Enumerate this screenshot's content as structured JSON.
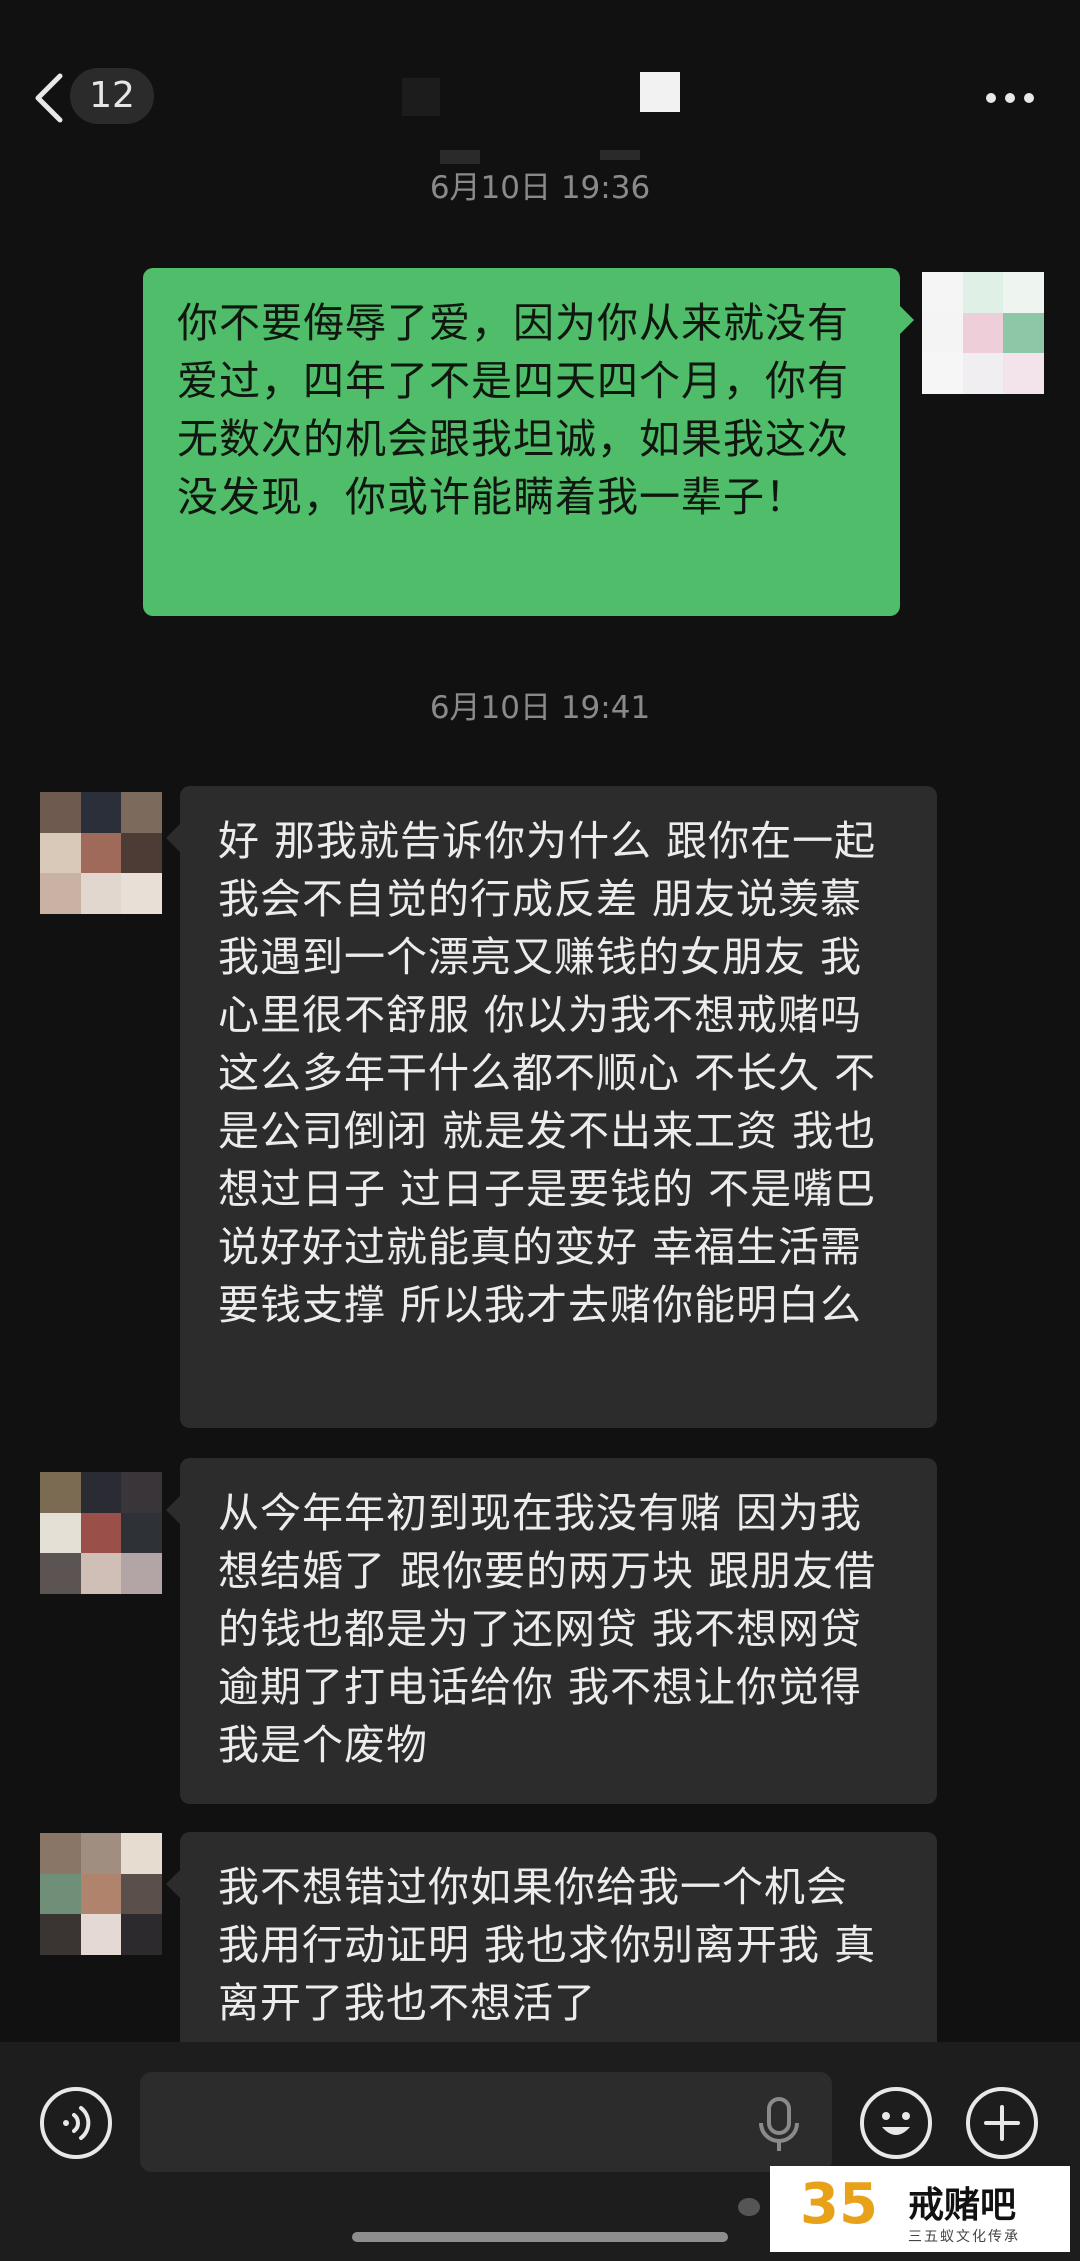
{
  "header": {
    "unread_count": "12",
    "back_icon": "chevron-left-icon",
    "more_icon": "more-dots-icon"
  },
  "messages": {
    "time1": "6月10日 19:36",
    "sent_message": "你不要侮辱了爱，因为你从来就没有爱过，四年了不是四天四个月，你有无数次的机会跟我坦诚，如果我这次没发现，你或许能瞒着我一辈子！",
    "time2": "6月10日 19:41",
    "received_1": "好 那我就告诉你为什么 跟你在一起我会不自觉的行成反差 朋友说羡慕我遇到一个漂亮又赚钱的女朋友 我心里很不舒服 你以为我不想戒赌吗 这么多年干什么都不顺心 不长久 不是公司倒闭 就是发不出来工资 我也想过日子 过日子是要钱的 不是嘴巴说好好过就能真的变好 幸福生活需要钱支撑 所以我才去赌你能明白么",
    "received_2": "从今年年初到现在我没有赌 因为我想结婚了 跟你要的两万块 跟朋友借的钱也都是为了还网贷 我不想网贷逾期了打电话给你 我不想让你觉得我是个废物",
    "received_3": "我不想错过你如果你给我一个机会 我用行动证明 我也求你别离开我 真离开了我也不想活了"
  },
  "input_bar": {
    "voice_icon": "voice-mode-icon",
    "mic_icon": "microphone-icon",
    "emoji_icon": "emoji-icon",
    "plus_icon": "plus-icon",
    "value": ""
  },
  "watermark": {
    "number": "35",
    "name": "戒赌吧",
    "sub": "三五蚁文化传承"
  },
  "colors": {
    "background": "#111111",
    "sent_bubble": "#4fbd6a",
    "received_bubble": "#2c2c2c",
    "timestamp": "#8a8a8a"
  }
}
